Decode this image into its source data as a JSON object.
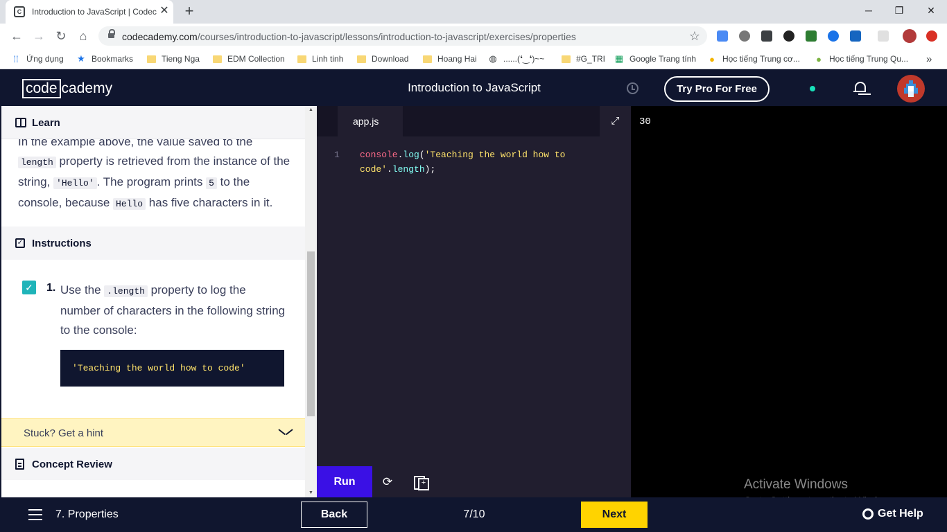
{
  "browser": {
    "tab_title": "Introduction to JavaScript | Codecademy",
    "tab_close_glyph": "✕",
    "new_tab_glyph": "+",
    "window_controls": {
      "minimize": "─",
      "maximize": "❐",
      "close": "✕"
    },
    "nav": {
      "back": "←",
      "forward": "→",
      "reload": "↻",
      "home": "⌂"
    },
    "url_host": "codecademy.com",
    "url_path": "/courses/introduction-to-javascript/lessons/introduction-to-javascript/exercises/properties",
    "star_glyph": "☆",
    "bookmarks": [
      {
        "label": "Ứng dụng",
        "icon": "apps-icon"
      },
      {
        "label": "Bookmarks",
        "icon": "star-icon"
      },
      {
        "label": "Tieng Nga",
        "icon": "folder-icon"
      },
      {
        "label": "EDM Collection",
        "icon": "folder-icon"
      },
      {
        "label": "Linh tinh",
        "icon": "folder-icon"
      },
      {
        "label": "Download",
        "icon": "folder-icon"
      },
      {
        "label": "Hoang Hai",
        "icon": "folder-icon"
      },
      {
        "label": "......(❛‿❛)~~",
        "icon": "globe-icon"
      },
      {
        "label": "#G_TRI",
        "icon": "folder-icon"
      },
      {
        "label": "Google Trang tính",
        "icon": "sheets-icon"
      },
      {
        "label": "Học tiếng Trung cơ...",
        "icon": "site-icon"
      },
      {
        "label": "Học tiếng Trung Qu...",
        "icon": "site-icon"
      }
    ],
    "more_bookmarks": "»"
  },
  "header": {
    "logo_box": "code",
    "logo_rest": "cademy",
    "course_title": "Introduction to JavaScript",
    "try_pro": "Try Pro For Free"
  },
  "learn": {
    "heading": "Learn",
    "text_before_1": "In the example above, the value saved to the ",
    "code_1": "length",
    "text_after_1": " property is retrieved from the instance of the string, ",
    "code_2": "'Hello'",
    "text_after_2": ". The program prints ",
    "code_3": "5",
    "text_after_3": " to the console, because ",
    "code_4": "Hello",
    "text_after_4": " has five characters in it."
  },
  "instructions": {
    "heading": "Instructions",
    "checkbox_glyph": "✓",
    "task_number": "1.",
    "task_before": "Use the ",
    "task_code": ".length",
    "task_after": " property to log the number of characters in the following string to the console:",
    "snippet": "'Teaching the world how to code'"
  },
  "hint": {
    "label": "Stuck? Get a hint"
  },
  "concept_review": {
    "heading": "Concept Review"
  },
  "editor": {
    "file_name": "app.js",
    "expand_glyph": "⤢",
    "line_number": "1",
    "code_obj": "console",
    "code_dot1": ".",
    "code_fn": "log",
    "code_open": "(",
    "code_str": "'Teaching the world how to code'",
    "code_dot2": ".",
    "code_prop": "length",
    "code_close": ");",
    "run_label": "Run",
    "refresh_glyph": "⟳"
  },
  "output": {
    "text": "30",
    "activate_title": "Activate Windows",
    "activate_sub": "Go to Settings to activate Windows."
  },
  "footer": {
    "lesson_name": "7. Properties",
    "back_label": "Back",
    "progress": "7/10",
    "next_label": "Next",
    "help_label": "Get Help"
  }
}
